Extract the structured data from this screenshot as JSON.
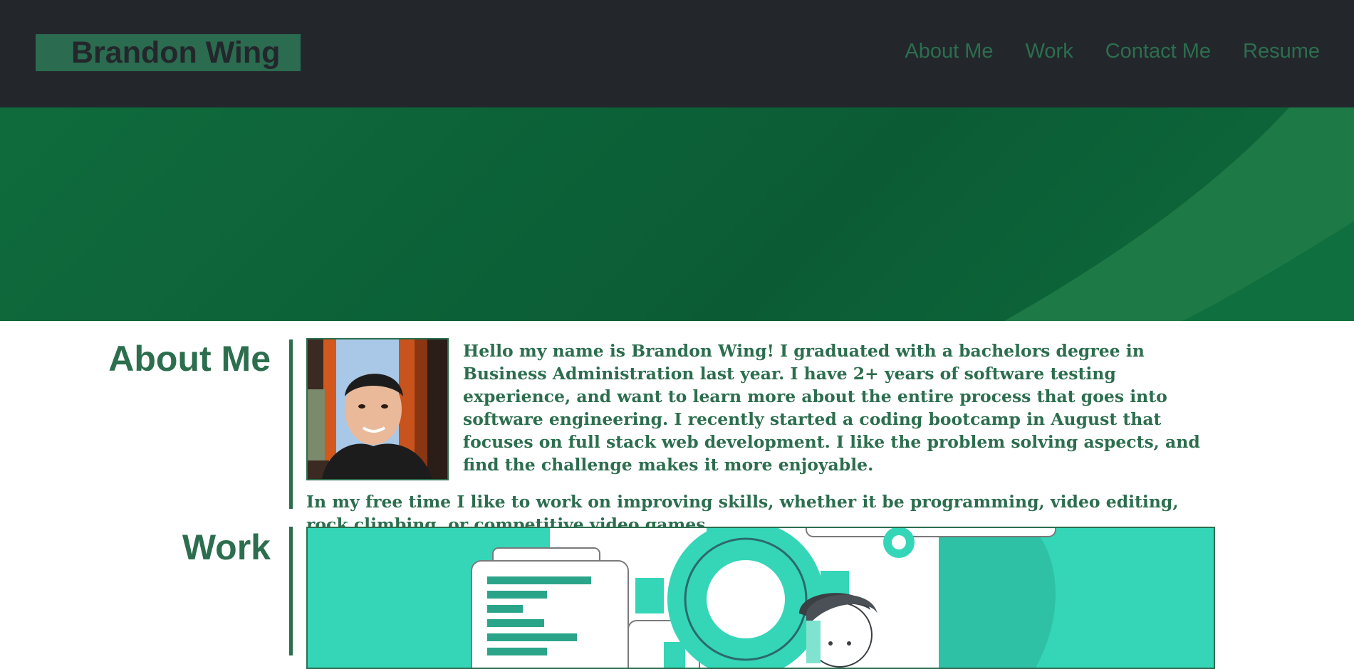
{
  "header": {
    "logo": "Brandon Wing",
    "nav": [
      "About Me",
      "Work",
      "Contact Me",
      "Resume"
    ]
  },
  "about": {
    "title": "About Me",
    "paragraphs": [
      "Hello my name is Brandon Wing! I graduated with a bachelors degree in Business Administration last year. I have 2+ years of software testing experience, and want to learn more about the entire process that goes into software engineering. I recently started a coding bootcamp in August that focuses on full stack web development. I like the problem solving aspects, and find the challenge makes it more enjoyable.",
      "In my free time I like to work on improving skills, whether it be programming, video editing, rock climbing, or competitive video games."
    ]
  },
  "work": {
    "title": "Work"
  },
  "colors": {
    "header_bg": "#23272c",
    "accent": "#2c6e4e",
    "hero": "#0f6b3c",
    "work_bg": "#35d6b8"
  }
}
